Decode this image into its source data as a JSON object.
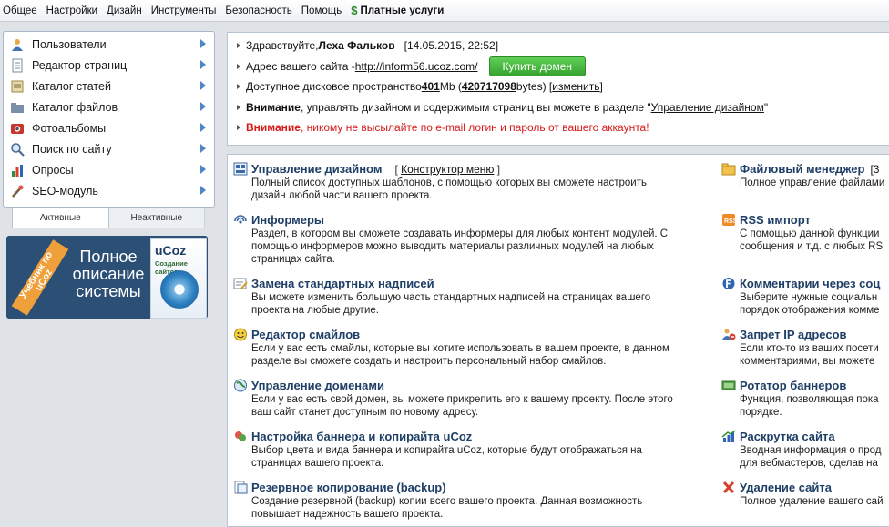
{
  "topmenu": {
    "items": [
      "Общее",
      "Настройки",
      "Дизайн",
      "Инструменты",
      "Безопасность",
      "Помощь"
    ],
    "paid": "Платные услуги"
  },
  "sidebar": {
    "items": [
      {
        "label": "Пользователи",
        "icon": "users-icon"
      },
      {
        "label": "Редактор страниц",
        "icon": "page-editor-icon"
      },
      {
        "label": "Каталог статей",
        "icon": "articles-icon"
      },
      {
        "label": "Каталог файлов",
        "icon": "files-icon"
      },
      {
        "label": "Фотоальбомы",
        "icon": "photo-albums-icon"
      },
      {
        "label": "Поиск по сайту",
        "icon": "site-search-icon"
      },
      {
        "label": "Опросы",
        "icon": "polls-icon"
      },
      {
        "label": "SEO-модуль",
        "icon": "seo-icon"
      }
    ],
    "tabs": {
      "active": "Активные",
      "inactive": "Неактивные"
    }
  },
  "banner": {
    "ribbon": "Учебник по uCoz",
    "line1": "Полное",
    "line2": "описание",
    "line3": "системы",
    "book_brand": "uCoz",
    "book_sub": "Создание сайтов"
  },
  "info": {
    "greeting_prefix": "Здравствуйте, ",
    "user": "Леха Фальков",
    "datetime": "[14.05.2015, 22:52]",
    "site_label": "Адрес вашего сайта - ",
    "site_url": "http://inform56.ucoz.com/",
    "buy_domain": "Купить домен",
    "disk_label": "Доступное дисковое пространство ",
    "disk_mb": "401",
    "disk_mb_unit": " Mb (",
    "disk_bytes": "420717098",
    "disk_bytes_unit": " bytes) [",
    "disk_change": "изменить",
    "disk_close": "]",
    "warn1_bold": "Внимание",
    "warn1_text": ", управлять дизайном и содержимым страниц вы можете в разделе \"",
    "warn1_link": "Управление дизайном",
    "warn1_end": "\"",
    "warn2_bold": "Внимание",
    "warn2_text": ", никому не высылайте по e-mail логин и пароль от вашего аккаунта!"
  },
  "modules": {
    "left": [
      {
        "title": "Управление дизайном",
        "extra_open": "[ ",
        "extra": "Конструктор меню",
        "extra_close": " ]",
        "desc": [
          "Полный список доступных шаблонов, с помощью которых вы сможете настроить",
          "дизайн любой части вашего проекта."
        ]
      },
      {
        "title": "Информеры",
        "desc": [
          "Раздел, в котором вы сможете создавать информеры для любых контент модулей. С",
          "помощью информеров можно выводить материалы различных модулей на любых",
          "страницах сайта."
        ]
      },
      {
        "title": "Замена стандартных надписей",
        "desc": [
          "Вы можете изменить большую часть стандартных надписей на страницах вашего",
          "проекта на любые другие."
        ]
      },
      {
        "title": "Редактор смайлов",
        "desc": [
          "Если у вас есть смайлы, которые вы хотите использовать в вашем проекте, в данном",
          "разделе вы сможете создать и настроить персональный набор смайлов."
        ]
      },
      {
        "title": "Управление доменами",
        "desc": [
          "Если у вас есть свой домен, вы можете прикрепить его к вашему проекту. После этого",
          "ваш сайт станет доступным по новому адресу."
        ]
      },
      {
        "title": "Настройка баннера и копирайта uCoz",
        "desc": [
          "Выбор цвета и вида баннера и копирайта uCoz, которые будут отображаться на",
          "страницах вашего проекта."
        ]
      },
      {
        "title": "Резервное копирование (backup)",
        "desc": [
          "Создание резервной (backup) копии всего вашего проекта. Данная возможность",
          "повышает надежность вашего проекта."
        ]
      }
    ],
    "right": [
      {
        "title": "Файловый менеджер",
        "extra": "[3",
        "desc": [
          "Полное управление файлами"
        ]
      },
      {
        "title": "RSS импорт",
        "desc": [
          "С помощью данной функции",
          "сообщения и т.д. с любых RS"
        ]
      },
      {
        "title": "Комментарии через соц",
        "desc": [
          "Выберите нужные социальн",
          "порядок отображения комме"
        ]
      },
      {
        "title": "Запрет IP адресов",
        "desc": [
          "Если кто-то из ваших посети",
          "комментариями, вы можете"
        ]
      },
      {
        "title": "Ротатор баннеров",
        "desc": [
          "Функция, позволяющая пока",
          "порядке."
        ]
      },
      {
        "title": "Раскрутка сайта",
        "desc": [
          "Вводная информация о прод",
          "для вебмастеров, сделав на"
        ]
      },
      {
        "title": "Удаление сайта",
        "desc": [
          "Полное удаление вашего сай"
        ]
      }
    ]
  },
  "colors": {
    "accent": "#4f86c6",
    "title": "#1f3f66",
    "warning": "#d61a1a",
    "buy": "#37a32f"
  }
}
